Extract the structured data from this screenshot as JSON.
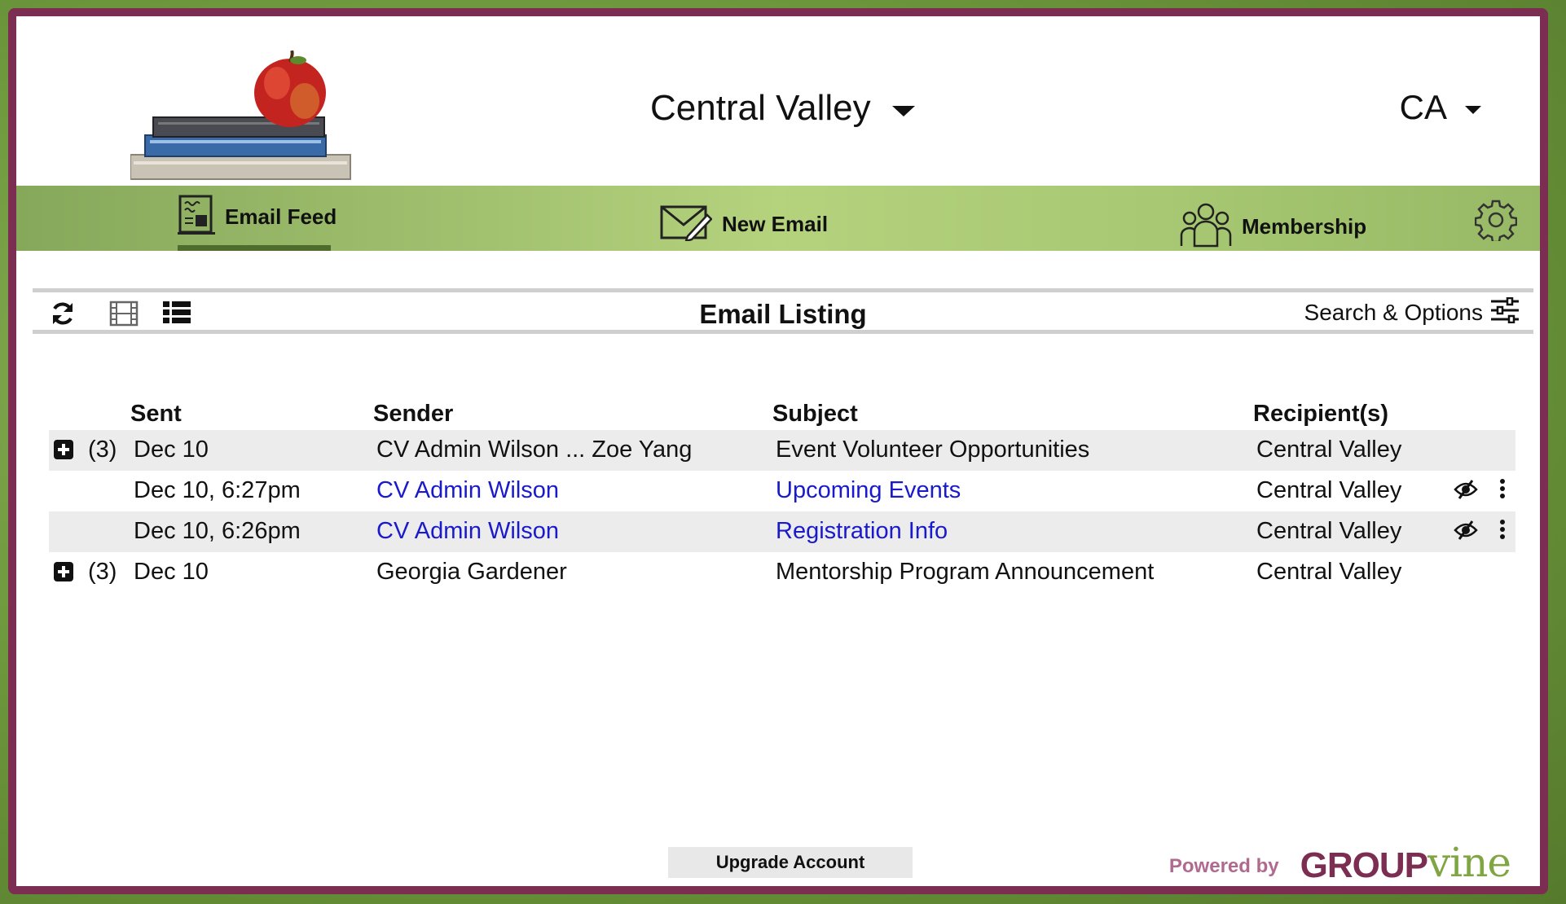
{
  "header": {
    "group_name": "Central Valley",
    "account_initials": "CA"
  },
  "nav": {
    "items": [
      {
        "label": "Email Feed",
        "icon": "newspaper-icon",
        "active": true
      },
      {
        "label": "New Email",
        "icon": "envelope-pen-icon",
        "active": false
      },
      {
        "label": "Membership",
        "icon": "people-group-icon",
        "active": false
      }
    ],
    "settings_icon": "gear-icon"
  },
  "toolbar": {
    "title": "Email Listing",
    "search_label": "Search & Options",
    "icons": [
      "refresh-icon",
      "film-strip-icon",
      "list-view-icon",
      "sliders-icon"
    ]
  },
  "table": {
    "columns": [
      "Sent",
      "Sender",
      "Subject",
      "Recipient(s)"
    ],
    "rows": [
      {
        "expand": true,
        "count": "(3)",
        "sent": "Dec 10",
        "sender": "CV Admin Wilson ... Zoe Yang",
        "subject": "Event Volunteer Opportunities",
        "recipients": "Central Valley",
        "link": false,
        "shaded": true
      },
      {
        "expand": false,
        "count": "",
        "sent": "Dec 10, 6:27pm",
        "sender": "CV Admin Wilson",
        "subject": "Upcoming Events",
        "recipients": "Central Valley",
        "link": true,
        "shaded": false
      },
      {
        "expand": false,
        "count": "",
        "sent": "Dec 10, 6:26pm",
        "sender": "CV Admin Wilson",
        "subject": "Registration Info",
        "recipients": "Central Valley",
        "link": true,
        "shaded": true
      },
      {
        "expand": true,
        "count": "(3)",
        "sent": "Dec 10",
        "sender": "Georgia Gardener",
        "subject": "Mentorship Program Announcement",
        "recipients": "Central Valley",
        "link": false,
        "shaded": false
      }
    ]
  },
  "footer": {
    "upgrade_label": "Upgrade Account",
    "powered_by": "Powered by",
    "brand_part1": "GROUP",
    "brand_part2": "vine"
  },
  "colors": {
    "frame": "#7b2d52",
    "nav_green": "#a8c873",
    "link_blue": "#1a1acc",
    "row_shade": "#ececec"
  }
}
